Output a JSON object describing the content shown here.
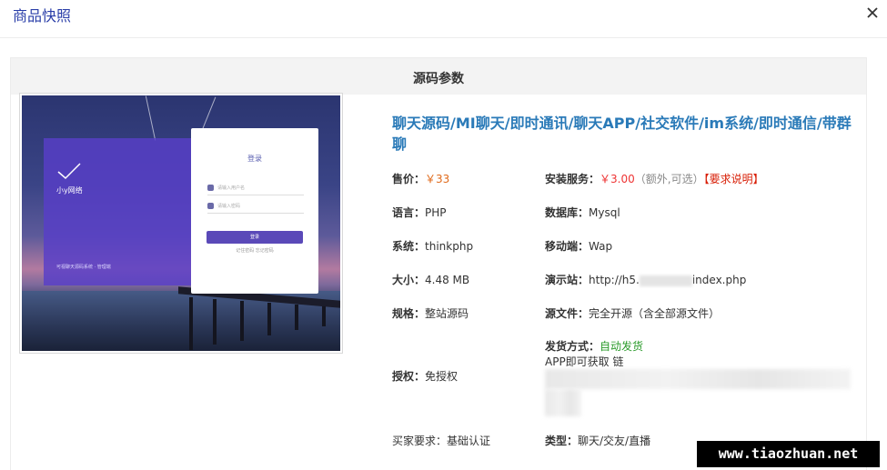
{
  "dialog": {
    "title": "商品快照",
    "close_icon": "close-icon"
  },
  "panel": {
    "title": "源码参数"
  },
  "preview": {
    "login_title": "登录",
    "username_placeholder": "请输入用户名",
    "password_placeholder": "请输入密码",
    "login_button": "登录",
    "links": "记住密码  忘记密码",
    "brand": "小y网络",
    "brand_footer": "可视聊天源码系统 · 管理端"
  },
  "product": {
    "title": "聊天源码/MI聊天/即时通讯/聊天APP/社交软件/im系统/即时通信/带群聊",
    "price_label": "售价：",
    "price_value": "￥33",
    "install_label": "安装服务：",
    "install_value": "￥3.00",
    "install_note": "（额外,可选）",
    "install_req": "【要求说明】",
    "lang_label": "语言：",
    "lang_value": "PHP",
    "db_label": "数据库：",
    "db_value": "Mysql",
    "sys_label": "系统：",
    "sys_value": "thinkphp",
    "mobile_label": "移动端：",
    "mobile_value": "Wap",
    "size_label": "大小：",
    "size_value": "4.48 MB",
    "demo_label": "演示站：",
    "demo_prefix": "http://h5.",
    "demo_suffix": "index.php",
    "spec_label": "规格：",
    "spec_value": "整站源码",
    "src_label": "源文件：",
    "src_value": "完全开源（含全部源文件）",
    "ship_label": "发货方式：",
    "ship_value": "自动发货",
    "ship_note": "APP即可获取  链",
    "auth_label": "授权：",
    "auth_value": "免授权",
    "buyer_label": "买家要求：",
    "buyer_value": "基础认证",
    "type_label": "类型：",
    "type_value": "聊天/交友/直播"
  },
  "watermark": "www.tiaozhuan.net"
}
